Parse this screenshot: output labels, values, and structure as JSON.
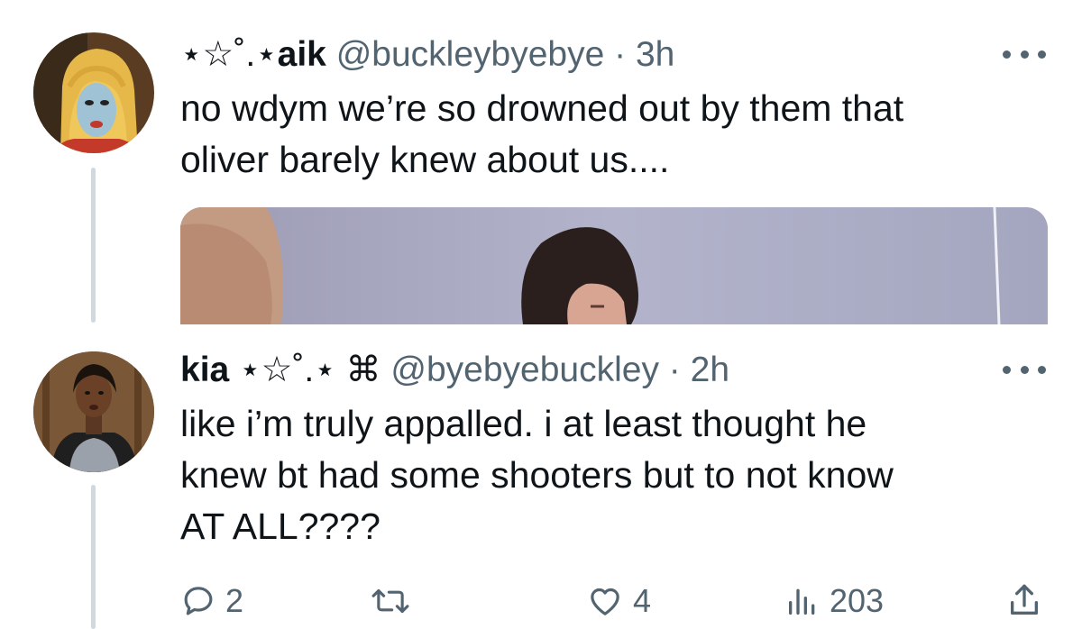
{
  "tweets": [
    {
      "decorated_name_prefix": "⋆☆˚.⋆",
      "name": "aik",
      "handle": "@buckleybyebye",
      "separator": "·",
      "time": "3h",
      "text": "no wdym we’re so drowned out by them that\noliver barely knew about us....",
      "avatar_icon": "avatar-blonde-wig",
      "has_media": true
    },
    {
      "name": "kia",
      "name_suffix": "⋆☆˚.⋆ ⌘",
      "handle": "@byebyebuckley",
      "separator": "·",
      "time": "2h",
      "text": "like i’m truly appalled. i at least thought he\nknew bt had some shooters but to not know\nAT ALL????",
      "avatar_icon": "avatar-woman-portrait",
      "actions": {
        "reply_count": "2",
        "retweet_count": "",
        "like_count": "4",
        "views_count": "203"
      }
    }
  ],
  "icons": {
    "reply": "reply-icon",
    "retweet": "retweet-icon",
    "like": "heart-icon",
    "views": "views-chart-icon",
    "share": "share-icon",
    "more": "more-options-icon"
  },
  "colors": {
    "text_primary": "#0f1419",
    "text_secondary": "#536471",
    "thread_line": "#cfd9de"
  }
}
